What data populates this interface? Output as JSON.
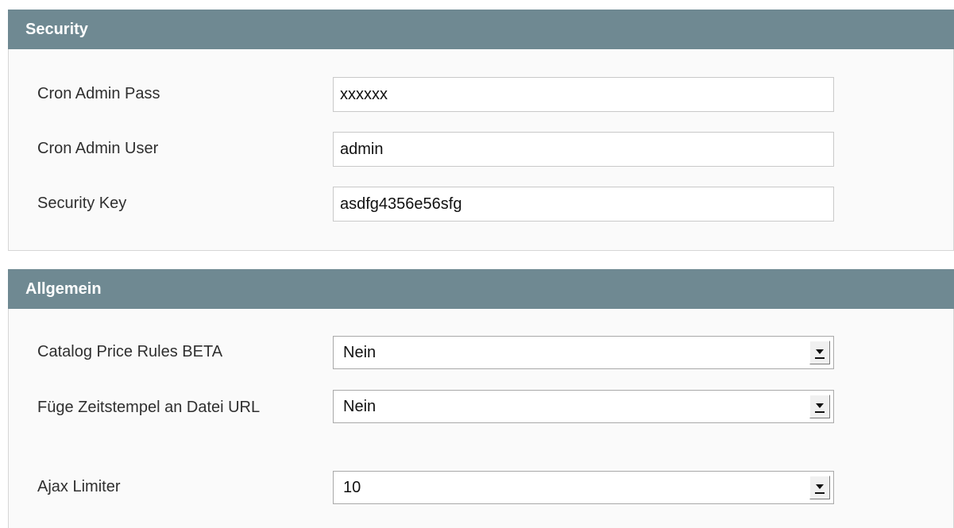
{
  "sections": {
    "security": {
      "title": "Security",
      "fields": [
        {
          "label": "Cron Admin Pass",
          "value": "xxxxxx"
        },
        {
          "label": "Cron Admin User",
          "value": "admin"
        },
        {
          "label": "Security Key",
          "value": "asdfg4356e56sfg"
        }
      ]
    },
    "allgemein": {
      "title": "Allgemein",
      "fields": [
        {
          "label": "Catalog Price Rules BETA",
          "value": "Nein"
        },
        {
          "label": "Füge Zeitstempel an Datei URL",
          "value": "Nein"
        },
        {
          "label": "Ajax Limiter",
          "value": "10"
        }
      ]
    }
  },
  "icons": {
    "select_arrow": "chevron-down-icon"
  },
  "colors": {
    "section_header_bg": "#6f8992",
    "section_header_text": "#ffffff",
    "section_body_bg": "#fafafa"
  }
}
